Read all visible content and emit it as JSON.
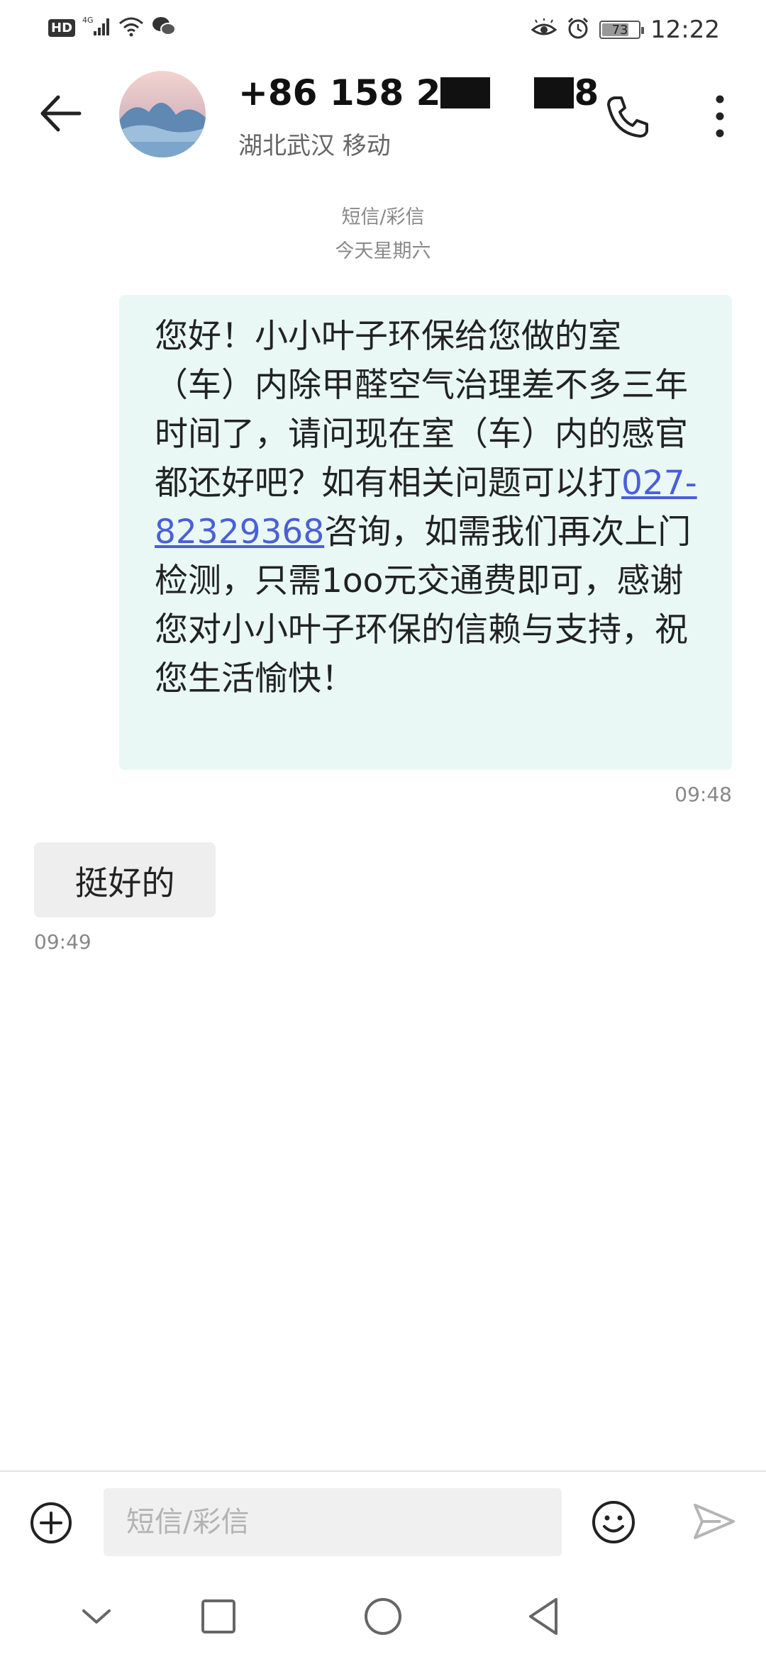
{
  "status_bar": {
    "hd": "HD",
    "network": "4G",
    "battery": "73",
    "battery_level": 0.73,
    "time": "12:22"
  },
  "header": {
    "contact_name_start": "+86 158 2",
    "contact_name_end": "8",
    "location": "湖北武汉 移动",
    "icons": [
      "back-arrow-icon",
      "avatar",
      "phone-icon",
      "more-vertical-icon"
    ]
  },
  "conversation": {
    "channel_label": "短信/彩信",
    "date_label": "今天星期六",
    "messages": [
      {
        "direction": "incoming-green",
        "text_before_link": "您好！小小叶子环保给您做的室（车）内除甲醛空气治理差不多三年时间了，请问现在室（车）内的感官都还好吧？如有相关问题可以打",
        "link": "027-82329368",
        "text_after_link": "咨询，如需我们再次上门检测，只需1oo元交通费即可，感谢您对小小叶子环保的信赖与支持，祝您生活愉快！",
        "time": "09:48"
      },
      {
        "direction": "outgoing-grey",
        "text": "挺好的",
        "time": "09:49"
      }
    ]
  },
  "composer": {
    "placeholder": "短信/彩信",
    "icons": [
      "plus-circle-icon",
      "emoji-icon",
      "send-icon"
    ]
  },
  "nav_bar": {
    "icons": [
      "chevron-down-icon",
      "square-icon",
      "circle-icon",
      "back-triangle-icon"
    ]
  }
}
